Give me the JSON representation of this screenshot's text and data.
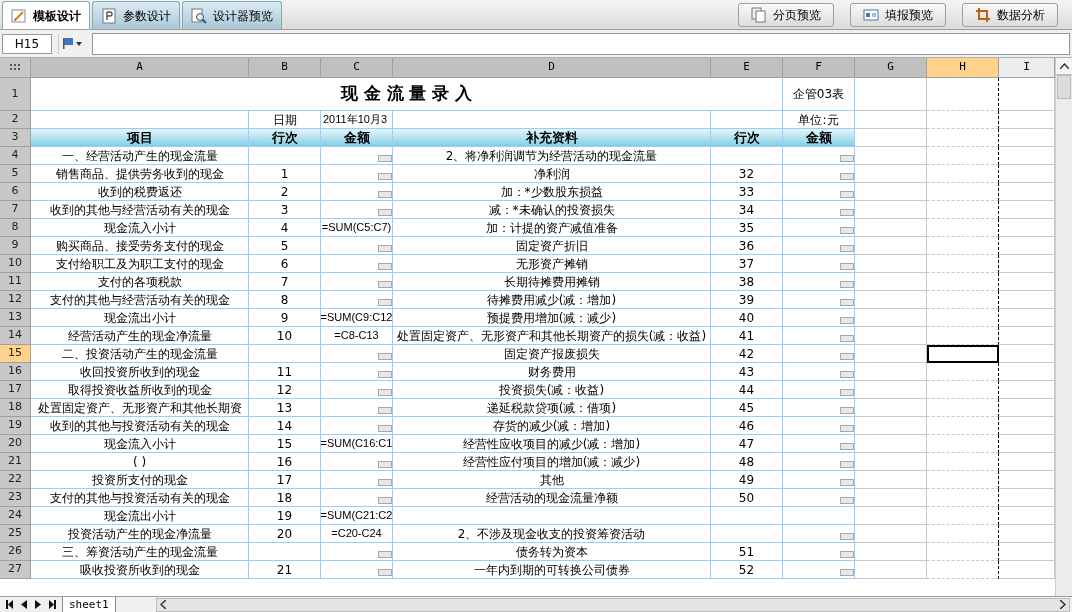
{
  "tabs": [
    {
      "label": "模板设计",
      "selected": true
    },
    {
      "label": "参数设计",
      "selected": false
    },
    {
      "label": "设计器预览",
      "selected": false
    }
  ],
  "buttons": [
    {
      "label": "分页预览"
    },
    {
      "label": "填报预览"
    },
    {
      "label": "数据分析"
    }
  ],
  "formula_bar": {
    "cell_ref": "H15"
  },
  "columns": [
    {
      "label": "A",
      "selected": false
    },
    {
      "label": "B",
      "selected": false
    },
    {
      "label": "C",
      "selected": false
    },
    {
      "label": "D",
      "selected": false
    },
    {
      "label": "E",
      "selected": false
    },
    {
      "label": "F",
      "selected": false
    },
    {
      "label": "G",
      "selected": false
    },
    {
      "label": "H",
      "selected": true
    },
    {
      "label": "I",
      "selected": false
    }
  ],
  "rows": [
    {
      "num": "1",
      "kind": "title",
      "title": "现 金 流 量 录 入",
      "f": "企管03表",
      "selected": false
    },
    {
      "num": "2",
      "kind": "info",
      "b": "日期",
      "c": "2011年10月3",
      "f": "单位:元",
      "selected": false
    },
    {
      "num": "3",
      "kind": "header",
      "a": "项目",
      "b": "行次",
      "c": "金额",
      "d": "补充资料",
      "e": "行次",
      "f": "金额",
      "selected": false
    },
    {
      "num": "4",
      "kind": "data",
      "a": "一、经营活动产生的现金流量",
      "c_input": true,
      "d": "2、将净利润调节为经营活动的现金流量",
      "f_input": true,
      "selected": false
    },
    {
      "num": "5",
      "kind": "data",
      "a": "销售商品、提供劳务收到的现金",
      "b": "1",
      "c_input": true,
      "d": "净利润",
      "e": "32",
      "f_input": true,
      "selected": false
    },
    {
      "num": "6",
      "kind": "data",
      "a": "收到的税费返还",
      "b": "2",
      "c_input": true,
      "d": "加：*少数股东损益",
      "e": "33",
      "f_input": true,
      "selected": false
    },
    {
      "num": "7",
      "kind": "data",
      "a": "收到的其他与经营活动有关的现金",
      "b": "3",
      "c_input": true,
      "d": "减：*未确认的投资损失",
      "e": "34",
      "f_input": true,
      "selected": false
    },
    {
      "num": "8",
      "kind": "data",
      "a": "现金流入小计",
      "b": "4",
      "c": "=SUM(C5:C7)",
      "c_input": false,
      "d": "加：计提的资产减值准备",
      "e": "35",
      "f_input": true,
      "selected": false
    },
    {
      "num": "9",
      "kind": "data",
      "a": "购买商品、接受劳务支付的现金",
      "b": "5",
      "c_input": true,
      "d": "固定资产折旧",
      "e": "36",
      "f_input": true,
      "selected": false
    },
    {
      "num": "10",
      "kind": "data",
      "a": "支付给职工及为职工支付的现金",
      "b": "6",
      "c_input": true,
      "d": "无形资产摊销",
      "e": "37",
      "f_input": true,
      "selected": false
    },
    {
      "num": "11",
      "kind": "data",
      "a": "支付的各项税款",
      "b": "7",
      "c_input": true,
      "d": "长期待摊费用摊销",
      "e": "38",
      "f_input": true,
      "selected": false
    },
    {
      "num": "12",
      "kind": "data",
      "a": "支付的其他与经营活动有关的现金",
      "b": "8",
      "c_input": true,
      "d": "待摊费用减少(减：增加)",
      "e": "39",
      "f_input": true,
      "selected": false
    },
    {
      "num": "13",
      "kind": "data",
      "a": "现金流出小计",
      "b": "9",
      "c": "=SUM(C9:C12",
      "c_input": false,
      "d": "预提费用增加(减：减少)",
      "e": "40",
      "f_input": true,
      "selected": false
    },
    {
      "num": "14",
      "kind": "data",
      "a": "经营活动产生的现金净流量",
      "b": "10",
      "c": "=C8-C13",
      "c_input": false,
      "d": "处置固定资产、无形资产和其他长期资产的损失(减：收益)",
      "e": "41",
      "f_input": true,
      "selected": false
    },
    {
      "num": "15",
      "kind": "data",
      "a": "二、投资活动产生的现金流量",
      "c_input": true,
      "d": "固定资产报废损失",
      "e": "42",
      "f_input": true,
      "selected": true
    },
    {
      "num": "16",
      "kind": "data",
      "a": "收回投资所收到的现金",
      "b": "11",
      "c_input": true,
      "d": "财务费用",
      "e": "43",
      "f_input": true,
      "selected": false
    },
    {
      "num": "17",
      "kind": "data",
      "a": "取得投资收益所收到的现金",
      "b": "12",
      "c_input": true,
      "d": "投资损失(减：收益)",
      "e": "44",
      "f_input": true,
      "selected": false
    },
    {
      "num": "18",
      "kind": "data",
      "a": "处置固定资产、无形资产和其他长期资",
      "b": "13",
      "c_input": true,
      "d": "递延税款贷项(减：借项)",
      "e": "45",
      "f_input": true,
      "selected": false
    },
    {
      "num": "19",
      "kind": "data",
      "a": "收到的其他与投资活动有关的现金",
      "b": "14",
      "c_input": true,
      "d": "存货的减少(减：增加)",
      "e": "46",
      "f_input": true,
      "selected": false
    },
    {
      "num": "20",
      "kind": "data",
      "a": "现金流入小计",
      "b": "15",
      "c": "=SUM(C16:C1",
      "c_input": false,
      "d": "经营性应收项目的减少(减：增加)",
      "e": "47",
      "f_input": true,
      "selected": false
    },
    {
      "num": "21",
      "kind": "data",
      "a": "( )",
      "b": "16",
      "c_input": true,
      "d": "经营性应付项目的增加(减：减少)",
      "e": "48",
      "f_input": true,
      "selected": false
    },
    {
      "num": "22",
      "kind": "data",
      "a": "投资所支付的现金",
      "b": "17",
      "c_input": true,
      "d": "其他",
      "e": "49",
      "f_input": true,
      "selected": false
    },
    {
      "num": "23",
      "kind": "data",
      "a": "支付的其他与投资活动有关的现金",
      "b": "18",
      "c_input": true,
      "d": "经营活动的现金流量净额",
      "e": "50",
      "f_input": true,
      "selected": false
    },
    {
      "num": "24",
      "kind": "data",
      "a": "现金流出小计",
      "b": "19",
      "c": "=SUM(C21:C2",
      "c_input": false,
      "f_input": false,
      "selected": false
    },
    {
      "num": "25",
      "kind": "data",
      "a": "投资活动产生的现金净流量",
      "b": "20",
      "c": "=C20-C24",
      "c_input": false,
      "d": "2、不涉及现金收支的投资筹资活动",
      "f_input": true,
      "selected": false
    },
    {
      "num": "26",
      "kind": "data",
      "a": "三、筹资活动产生的现金流量",
      "c_input": true,
      "d": "债务转为资本",
      "e": "51",
      "f_input": true,
      "selected": false
    },
    {
      "num": "27",
      "kind": "data",
      "a": "吸收投资所收到的现金",
      "b": "21",
      "c_input": true,
      "d": "一年内到期的可转换公司债券",
      "e": "52",
      "f_input": true,
      "selected": false
    }
  ],
  "sheet_tabs": [
    {
      "label": "sheet1",
      "selected": true
    }
  ]
}
